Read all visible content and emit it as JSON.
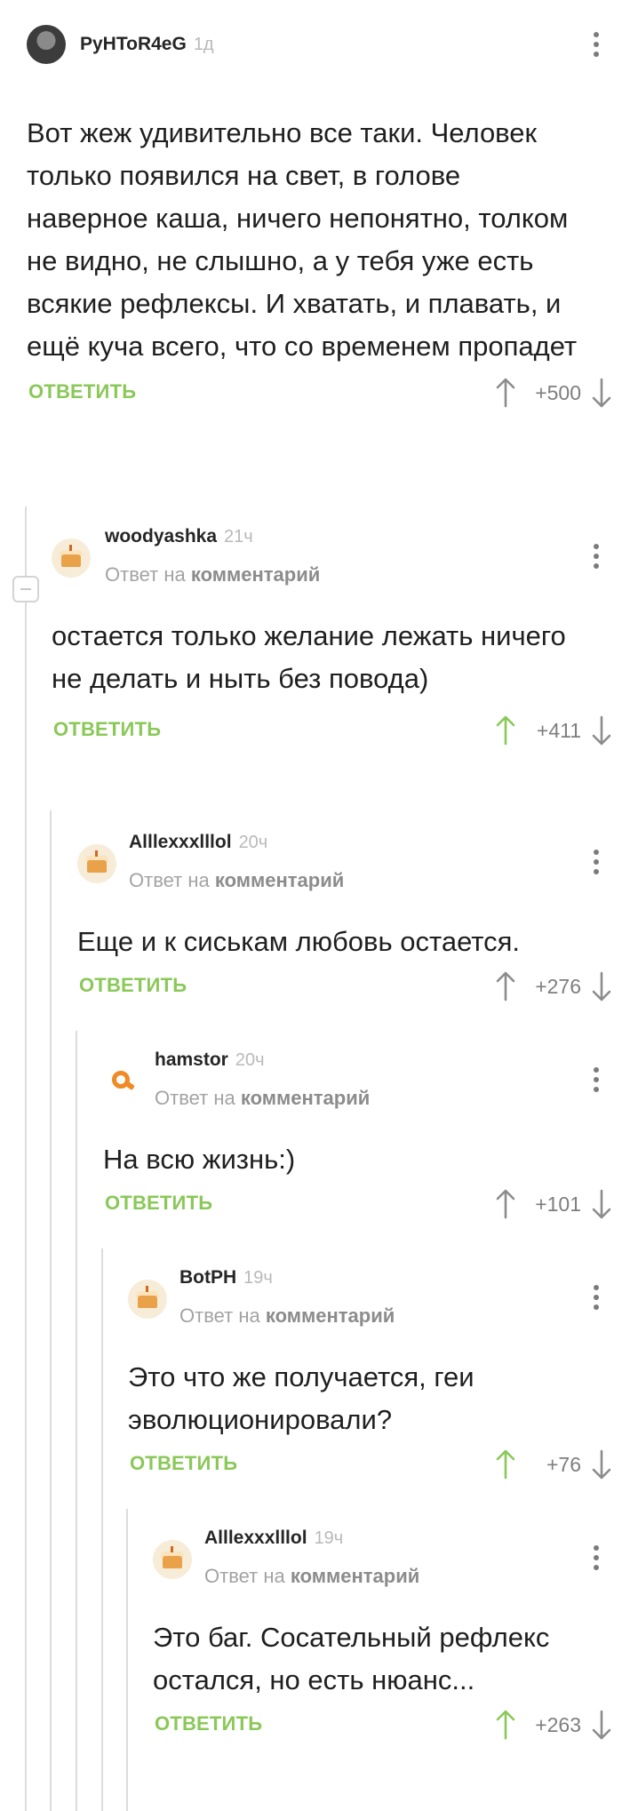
{
  "colors": {
    "accent_green": "#8ac858",
    "arrow_gray": "#8c8c8c",
    "thread_line": "#dcdcdc"
  },
  "labels": {
    "reply_to_prefix": "Ответ на",
    "reply_to_link": "комментарий",
    "reply_button": "ОТВЕТИТЬ"
  },
  "comments": [
    {
      "author": "PyHToR4eG",
      "time": "1д",
      "avatar": "user-photo",
      "reply_to": false,
      "text": "Вот жеж удивительно все таки. Человек только появился на свет, в голове наверное каша, ничего непонятно, толком не видно, не слышно, а у тебя уже есть всякие рефлексы. И хватать, и плавать, и ещё куча всего, что со временем пропадет",
      "score": "+500",
      "upvoted": false
    },
    {
      "author": "woodyashka",
      "time": "21ч",
      "avatar": "cake-icon",
      "reply_to": true,
      "text": "остается только желание лежать ничего не делать и ныть без повода)",
      "score": "+411",
      "upvoted": true
    },
    {
      "author": "Alllexxxlllol",
      "time": "20ч",
      "avatar": "cake-icon",
      "reply_to": true,
      "text": "Еще и к сиськам любовь остается.",
      "score": "+276",
      "upvoted": false
    },
    {
      "author": "hamstor",
      "time": "20ч",
      "avatar": "pikabu-logo-icon",
      "reply_to": true,
      "text": "На всю жизнь:)",
      "score": "+101",
      "upvoted": false
    },
    {
      "author": "BotPH",
      "time": "19ч",
      "avatar": "cake-icon",
      "reply_to": true,
      "text": "Это что же получается, геи эволюционировали?",
      "score": "+76",
      "upvoted": true
    },
    {
      "author": "Alllexxxlllol",
      "time": "19ч",
      "avatar": "cake-icon",
      "reply_to": true,
      "text": "Это баг. Сосательный рефлекс остался, но есть нюанс...",
      "score": "+263",
      "upvoted": true
    }
  ]
}
